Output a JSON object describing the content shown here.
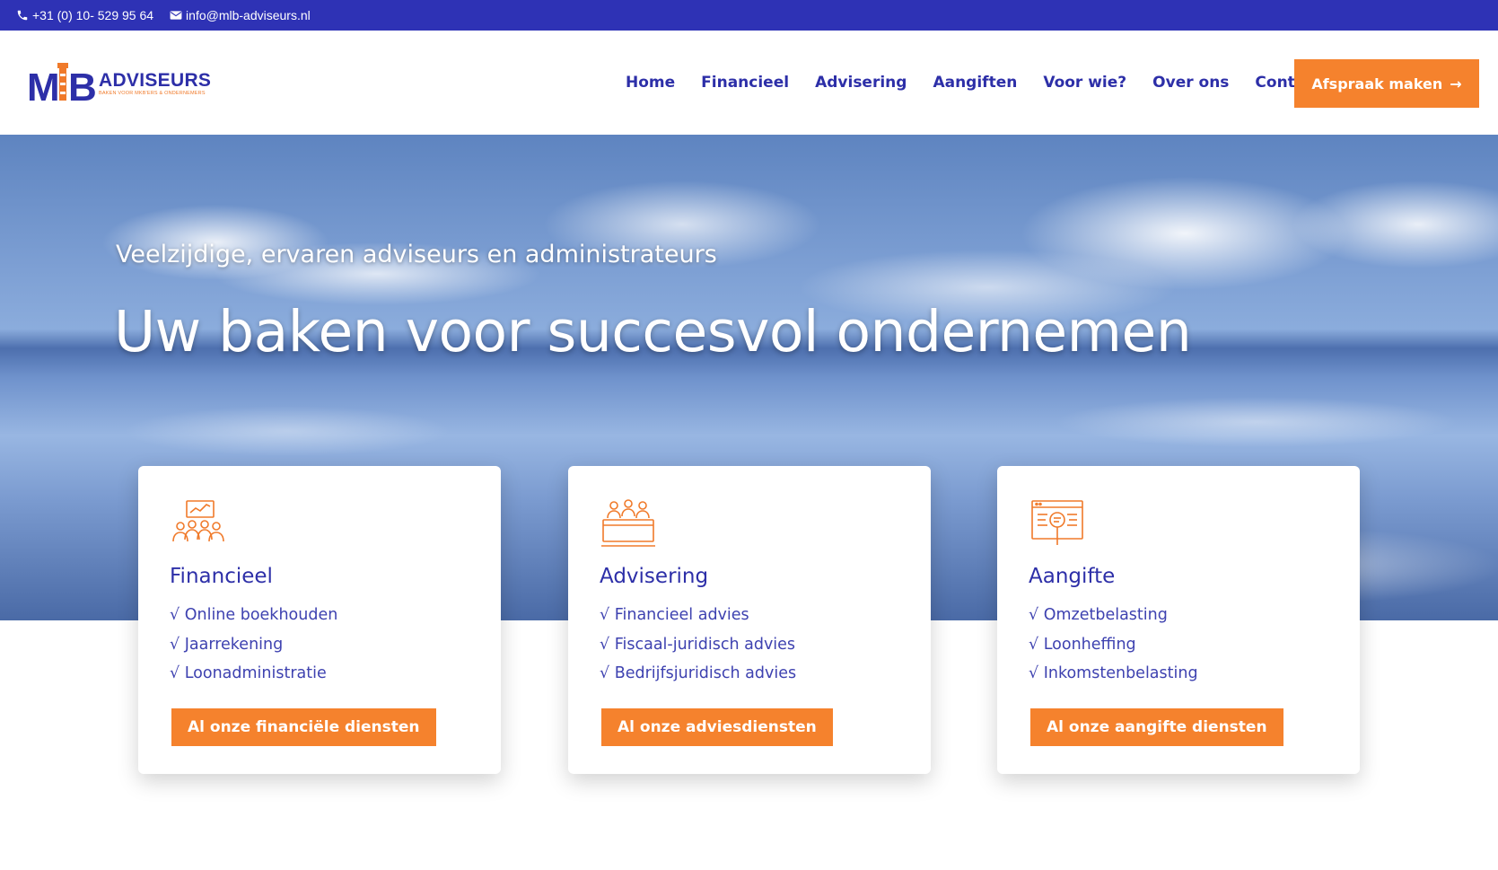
{
  "topbar": {
    "phone": "+31 (0) 10- 529 95 64",
    "email": "info@mlb-adviseurs.nl",
    "phone_icon": "phone-icon",
    "email_icon": "envelope-icon"
  },
  "logo": {
    "mark": "MLB",
    "word": "ADVISEURS",
    "tagline": "BAKEN VOOR MKB'ERS & ONDERNEMERS"
  },
  "nav": {
    "items": [
      "Home",
      "Financieel",
      "Advisering",
      "Aangiften",
      "Voor wie?",
      "Over ons",
      "Contact"
    ]
  },
  "cta": {
    "label": "Afspraak maken",
    "arrow": "→"
  },
  "hero": {
    "subtitle": "Veelzijdige, ervaren adviseurs en administrateurs",
    "title": "Uw baken voor succesvol ondernemen"
  },
  "cards": [
    {
      "icon": "financial-chart-people-icon",
      "title": "Financieel",
      "items": [
        "√ Online boekhouden",
        "√ Jaarrekening",
        "√ Loonadministratie"
      ],
      "button": "Al onze financiële diensten"
    },
    {
      "icon": "meeting-table-icon",
      "title": "Advisering",
      "items": [
        "√ Financieel advies",
        "√ Fiscaal-juridisch advies",
        "√ Bedrijfsjuridisch advies"
      ],
      "button": "Al onze adviesdiensten"
    },
    {
      "icon": "document-magnifier-icon",
      "title": "Aangifte",
      "items": [
        "√ Omzetbelasting",
        "√ Loonheffing",
        "√ Inkomstenbelasting"
      ],
      "button": "Al onze aangifte diensten"
    }
  ],
  "colors": {
    "topbar": "#2e32b5",
    "brand_blue": "#2d2fa8",
    "accent_orange": "#f5822d"
  }
}
